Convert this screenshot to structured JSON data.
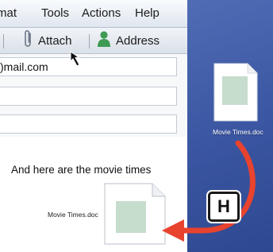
{
  "menu_bar": {
    "items": [
      "mat",
      "Tools",
      "Actions",
      "Help"
    ]
  },
  "toolbar": {
    "attach_label": "Attach",
    "address_label": "Address"
  },
  "compose": {
    "to_value": ")mail.com",
    "body_text": "And here are the movie times"
  },
  "attachment": {
    "filename": "Movie Times.doc"
  },
  "desktop": {
    "file_label": "Movie Times.doc"
  },
  "callout": {
    "letter": "H"
  },
  "colors": {
    "desktop_blue": "#3a55a1",
    "arrow_red": "#e8432e",
    "doc_green": "#c6dccd"
  }
}
